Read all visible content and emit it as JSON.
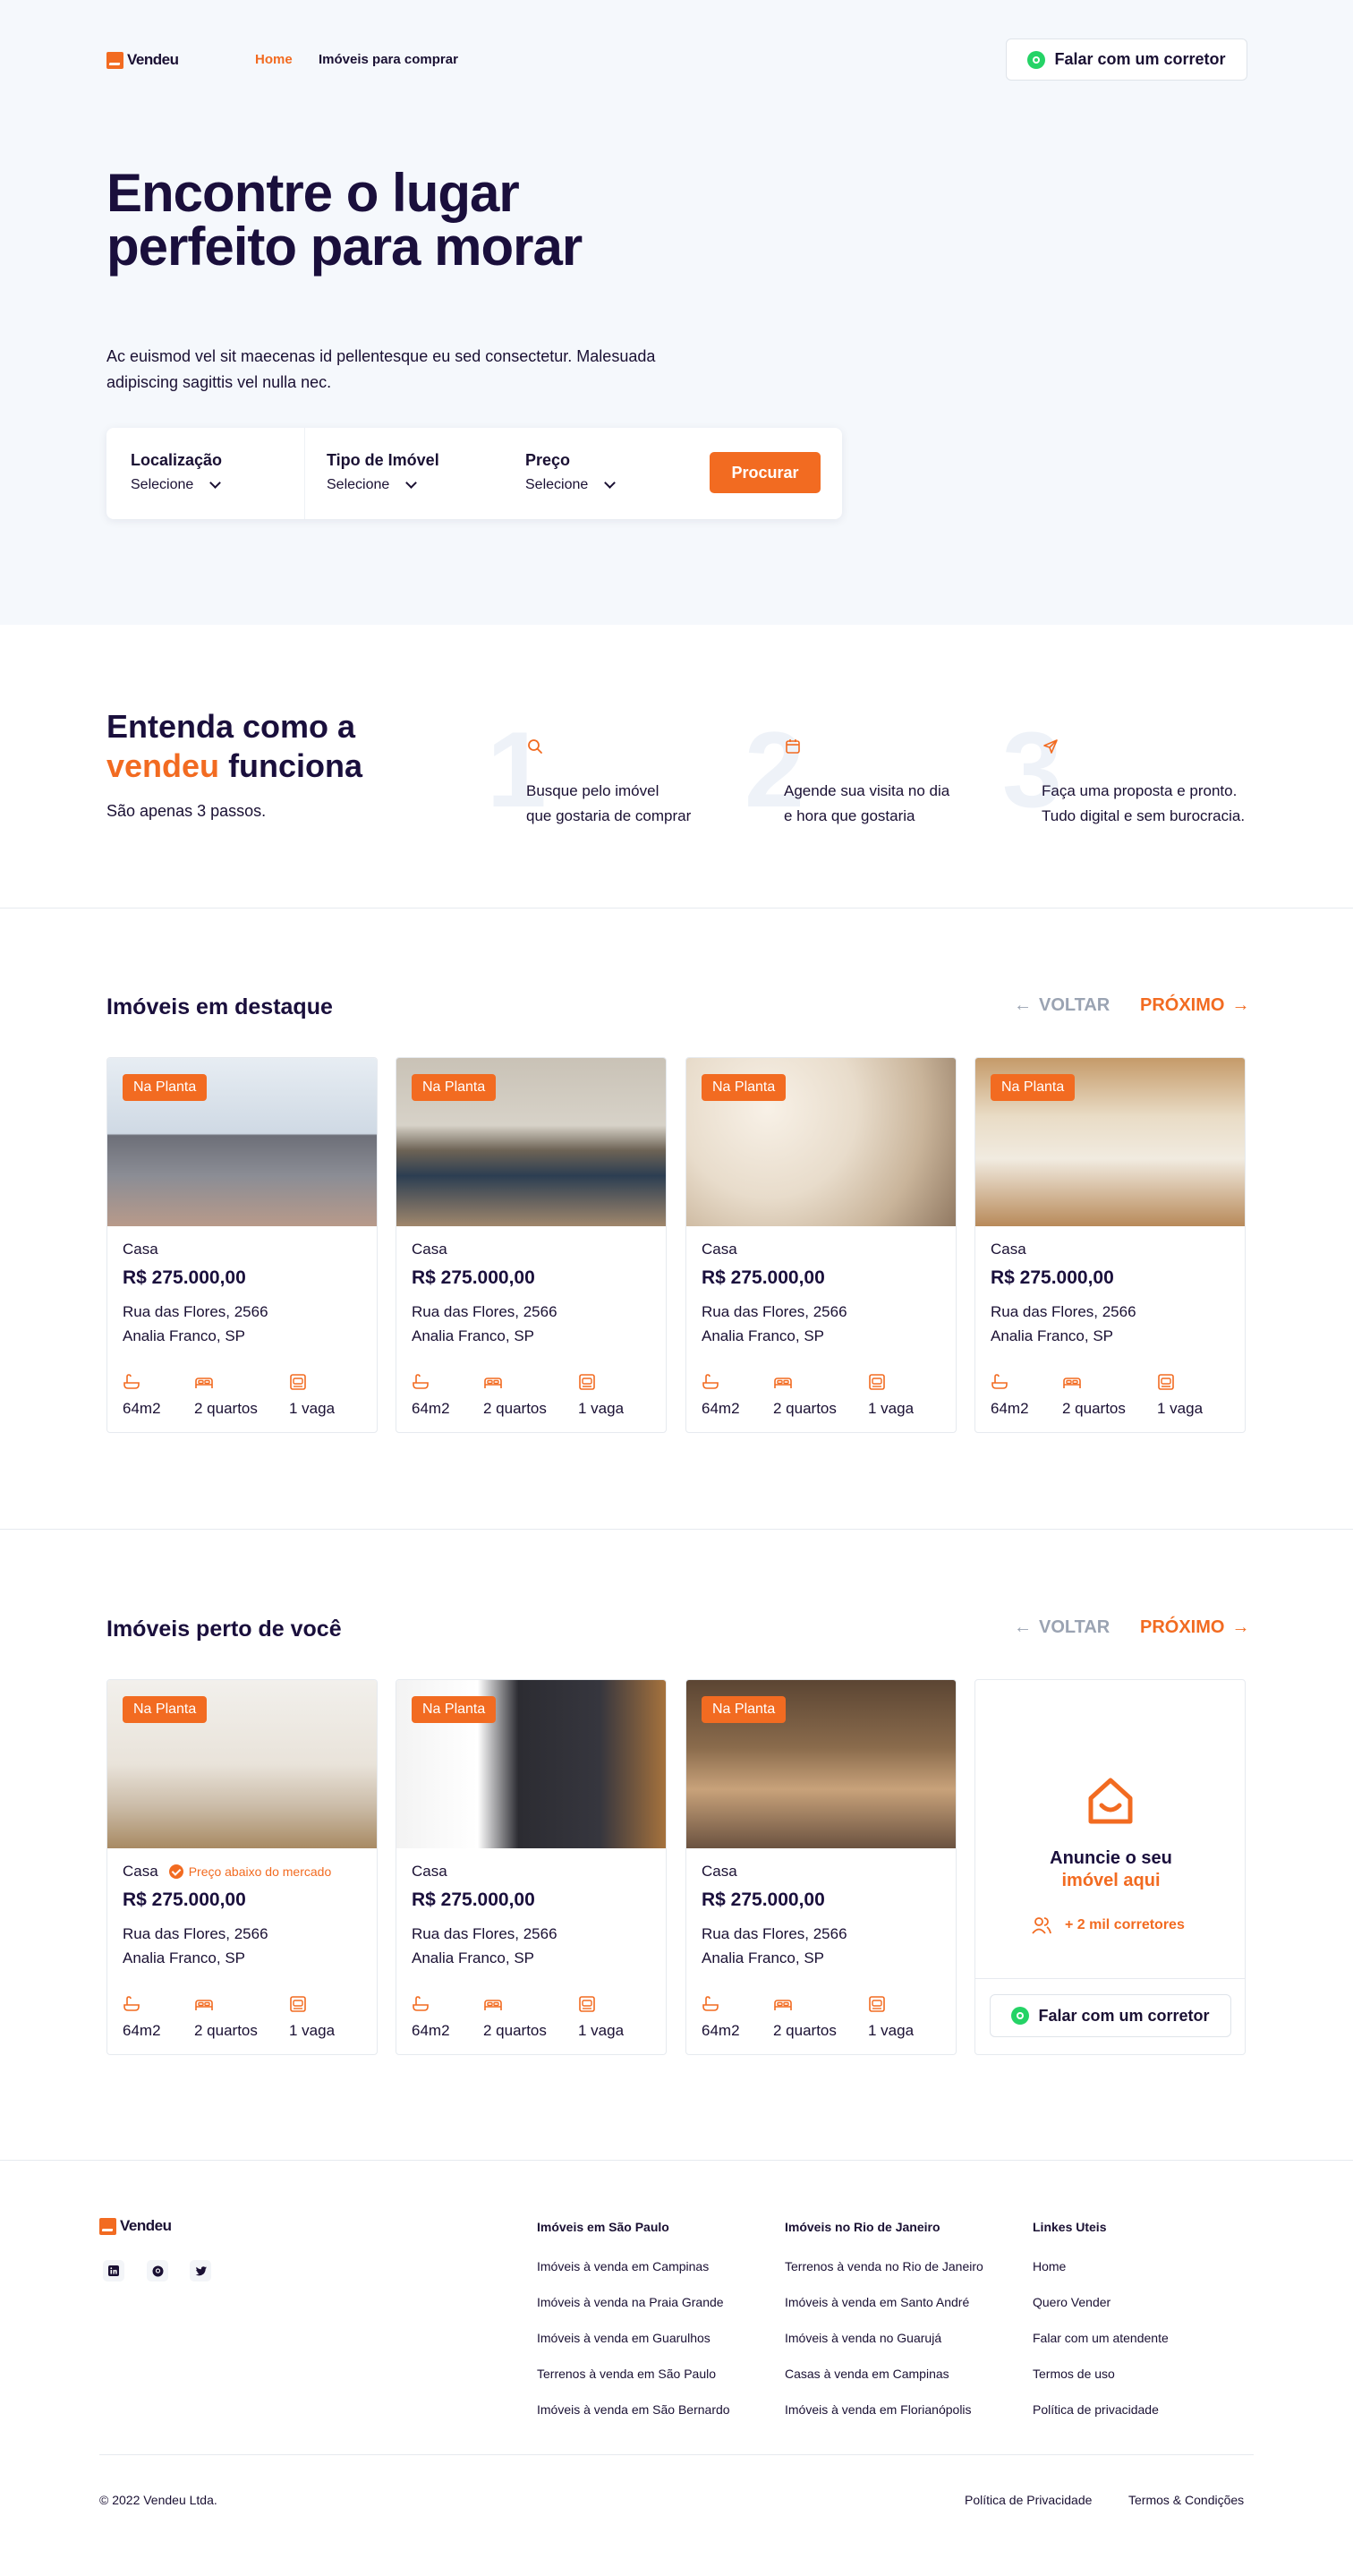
{
  "header": {
    "logo": "Vendeu",
    "nav": [
      "Home",
      "Imóveis para comprar"
    ],
    "cta": "Falar com um corretor"
  },
  "hero": {
    "title": "Encontre o lugar perfeito para morar",
    "subtitle": "Ac euismod vel sit maecenas id pellentesque eu sed consectetur. Malesuada adipiscing sagittis vel nulla nec.",
    "search": {
      "fields": [
        {
          "label": "Localização",
          "value": "Selecione"
        },
        {
          "label": "Tipo de Imóvel",
          "value": "Selecione"
        },
        {
          "label": "Preço",
          "value": "Selecione"
        }
      ],
      "button": "Procurar"
    }
  },
  "how": {
    "title_a": "Entenda como a",
    "title_brand": "vendeu",
    "title_b": "funciona",
    "subtitle": "São apenas 3 passos.",
    "steps": [
      {
        "num": "1",
        "icon": "search-icon",
        "line1": "Busque pelo imóvel",
        "line2": "que gostaria de comprar"
      },
      {
        "num": "2",
        "icon": "calendar-icon",
        "line1": "Agende sua visita no dia",
        "line2": "e hora que gostaria"
      },
      {
        "num": "3",
        "icon": "send-icon",
        "line1": "Faça uma proposta e pronto.",
        "line2": "Tudo digital e sem burocracia."
      }
    ]
  },
  "featured": {
    "title": "Imóveis em destaque",
    "prev": "VOLTAR",
    "next": "PRÓXIMO",
    "cards": [
      {
        "badge": "Na Planta",
        "type": "Casa",
        "price": "R$ 275.000,00",
        "street": "Rua das Flores, 2566",
        "area": "Analia Franco, SP",
        "size": "64m2",
        "rooms": "2 quartos",
        "parking": "1 vaga"
      },
      {
        "badge": "Na Planta",
        "type": "Casa",
        "price": "R$ 275.000,00",
        "street": "Rua das Flores, 2566",
        "area": "Analia Franco, SP",
        "size": "64m2",
        "rooms": "2 quartos",
        "parking": "1 vaga"
      },
      {
        "badge": "Na Planta",
        "type": "Casa",
        "price": "R$ 275.000,00",
        "street": "Rua das Flores, 2566",
        "area": "Analia Franco, SP",
        "size": "64m2",
        "rooms": "2 quartos",
        "parking": "1 vaga"
      },
      {
        "badge": "Na Planta",
        "type": "Casa",
        "price": "R$ 275.000,00",
        "street": "Rua das Flores, 2566",
        "area": "Analia Franco, SP",
        "size": "64m2",
        "rooms": "2 quartos",
        "parking": "1 vaga"
      }
    ]
  },
  "nearby": {
    "title": "Imóveis perto de você",
    "prev": "VOLTAR",
    "next": "PRÓXIMO",
    "cards": [
      {
        "badge": "Na Planta",
        "type": "Casa",
        "tag": "Preço abaixo do mercado",
        "price": "R$ 275.000,00",
        "street": "Rua das Flores, 2566",
        "area": "Analia Franco, SP",
        "size": "64m2",
        "rooms": "2 quartos",
        "parking": "1 vaga"
      },
      {
        "badge": "Na Planta",
        "type": "Casa",
        "price": "R$ 275.000,00",
        "street": "Rua das Flores, 2566",
        "area": "Analia Franco, SP",
        "size": "64m2",
        "rooms": "2 quartos",
        "parking": "1 vaga"
      },
      {
        "badge": "Na Planta",
        "type": "Casa",
        "price": "R$ 275.000,00",
        "street": "Rua das Flores, 2566",
        "area": "Analia Franco, SP",
        "size": "64m2",
        "rooms": "2 quartos",
        "parking": "1 vaga"
      }
    ],
    "promo": {
      "line1": "Anuncie o seu",
      "line2": "imóvel aqui",
      "brokers": "+ 2 mil corretores",
      "cta": "Falar com um corretor"
    }
  },
  "footer": {
    "logo": "Vendeu",
    "social": [
      "linkedin-icon",
      "github-icon",
      "twitter-icon"
    ],
    "columns": [
      {
        "title": "Imóveis em São Paulo",
        "links": [
          "Imóveis à venda em Campinas",
          "Imóveis à venda na Praia Grande",
          "Imóveis à venda em Guarulhos",
          "Terrenos à venda em São Paulo",
          "Imóveis à venda em São Bernardo"
        ]
      },
      {
        "title": "Imóveis no Rio de Janeiro",
        "links": [
          "Terrenos à venda no Rio de Janeiro",
          "Imóveis à venda em Santo André",
          "Imóveis à venda no Guarujá",
          "Casas à venda em Campinas",
          "Imóveis à venda em Florianópolis"
        ]
      },
      {
        "title": "Linkes Uteis",
        "links": [
          "Home",
          "Quero Vender",
          "Falar com um atendente",
          "Termos de uso",
          "Política de privacidade"
        ]
      }
    ],
    "copyright": "© 2022 Vendeu Ltda.",
    "legal": [
      "Política de Privacidade",
      "Termos & Condições"
    ]
  },
  "colors": {
    "accent": "#f26b21",
    "dark": "#1a0f3c",
    "hero_bg": "#f5f8fc",
    "whatsapp": "#25d366"
  }
}
